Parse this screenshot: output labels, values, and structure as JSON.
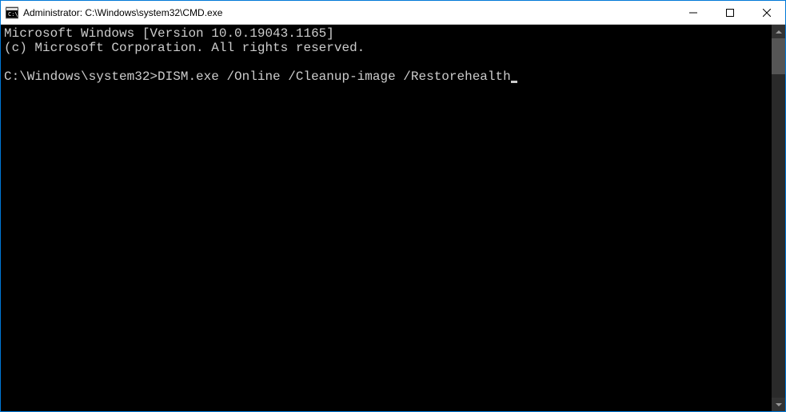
{
  "window": {
    "title": "Administrator: C:\\Windows\\system32\\CMD.exe"
  },
  "terminal": {
    "line1": "Microsoft Windows [Version 10.0.19043.1165]",
    "line2": "(c) Microsoft Corporation. All rights reserved.",
    "blank": "",
    "prompt": "C:\\Windows\\system32>",
    "command": "DISM.exe /Online /Cleanup-image /Restorehealth"
  }
}
